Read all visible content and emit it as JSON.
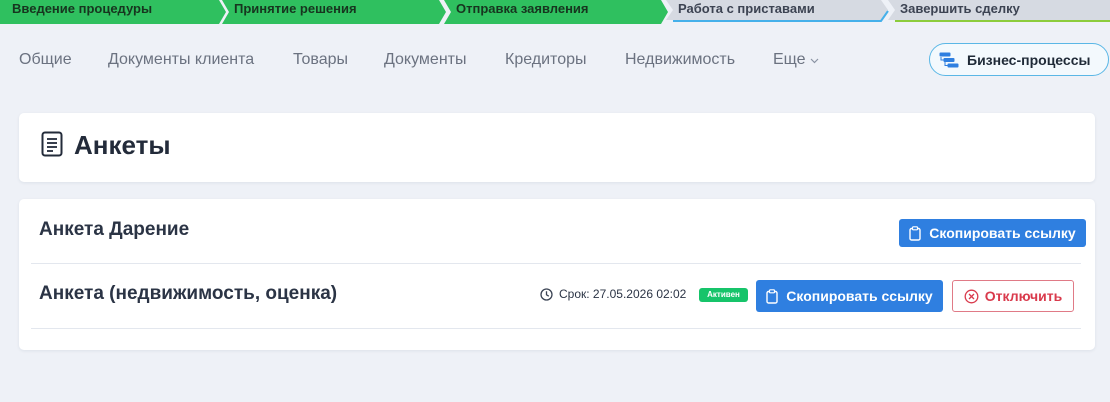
{
  "stages": [
    {
      "label": "Введение процедуры",
      "state": "done"
    },
    {
      "label": "Принятие решения",
      "state": "done"
    },
    {
      "label": "Отправка заявления",
      "state": "done"
    },
    {
      "label": "Работа с приставами",
      "state": "todo"
    },
    {
      "label": "Завершить сделку",
      "state": "todo"
    }
  ],
  "colors": {
    "stage_done": "#2fc05f",
    "stage_todo": "#d6dae2",
    "stage_todo_underline_blue": "#45b0ea",
    "stage_last_underline_green": "#8ccc3c",
    "primary": "#2f7fe0",
    "danger": "#d93a4c",
    "active_badge": "#16c46a"
  },
  "tabs": {
    "items": [
      {
        "label": "Общие"
      },
      {
        "label": "Документы клиента"
      },
      {
        "label": "Товары"
      },
      {
        "label": "Документы"
      },
      {
        "label": "Кредиторы"
      },
      {
        "label": "Недвижимость"
      },
      {
        "label": "Еще",
        "icon": "chevron-down-icon"
      }
    ],
    "business_processes_label": "Бизнес-процессы"
  },
  "page": {
    "title": "Анкеты",
    "title_icon": "document-icon"
  },
  "forms": [
    {
      "title": "Анкета Дарение",
      "copy_label": "Скопировать ссылку"
    },
    {
      "title": "Анкета (недвижимость, оценка)",
      "deadline": "Срок: 27.05.2026 02:02",
      "status": "Активен",
      "copy_label": "Скопировать ссылку",
      "disable_label": "Отключить"
    }
  ]
}
